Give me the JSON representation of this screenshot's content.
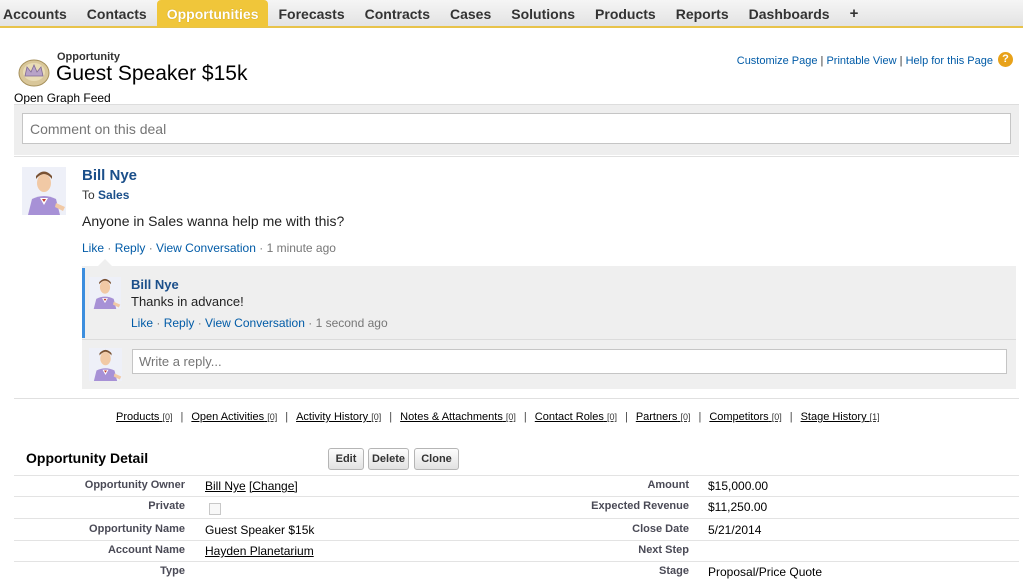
{
  "nav": {
    "tabs": [
      "Accounts",
      "Contacts",
      "Opportunities",
      "Forecasts",
      "Contracts",
      "Cases",
      "Solutions",
      "Products",
      "Reports",
      "Dashboards"
    ],
    "active": "Opportunities",
    "plus": "+"
  },
  "header": {
    "object_type": "Opportunity",
    "title": "Guest Speaker $15k",
    "links": [
      "Customize Page",
      "Printable View",
      "Help for this Page"
    ],
    "help_icon": "?"
  },
  "feed": {
    "label": "Open Graph Feed",
    "comment_placeholder": "Comment on this deal",
    "post": {
      "author": "Bill Nye",
      "to_prefix": "To",
      "to_group": "Sales",
      "body": "Anyone in Sales wanna help me with this?",
      "actions": [
        "Like",
        "Reply",
        "View Conversation"
      ],
      "time": "1 minute ago"
    },
    "comment": {
      "author": "Bill Nye",
      "body": "Thanks in advance!",
      "actions": [
        "Like",
        "Reply",
        "View Conversation"
      ],
      "time": "1 second ago"
    },
    "reply_placeholder": "Write a reply..."
  },
  "related": [
    {
      "label": "Products",
      "count": "[0]"
    },
    {
      "label": "Open Activities",
      "count": "[0]"
    },
    {
      "label": "Activity History",
      "count": "[0]"
    },
    {
      "label": "Notes & Attachments",
      "count": "[0]"
    },
    {
      "label": "Contact Roles",
      "count": "[0]"
    },
    {
      "label": "Partners",
      "count": "[0]"
    },
    {
      "label": "Competitors",
      "count": "[0]"
    },
    {
      "label": "Stage History",
      "count": "[1]"
    }
  ],
  "detail": {
    "title": "Opportunity Detail",
    "buttons": {
      "edit": "Edit",
      "delete": "Delete",
      "clone": "Clone"
    },
    "left": [
      {
        "label": "Opportunity Owner",
        "value": "Bill Nye",
        "extra": "[Change]"
      },
      {
        "label": "Private",
        "value": ""
      },
      {
        "label": "Opportunity Name",
        "value": "Guest Speaker $15k"
      },
      {
        "label": "Account Name",
        "value": "Hayden Planetarium"
      },
      {
        "label": "Type",
        "value": ""
      }
    ],
    "right": [
      {
        "label": "Amount",
        "value": "$15,000.00"
      },
      {
        "label": "Expected Revenue",
        "value": "$11,250.00"
      },
      {
        "label": "Close Date",
        "value": "5/21/2014"
      },
      {
        "label": "Next Step",
        "value": ""
      },
      {
        "label": "Stage",
        "value": "Proposal/Price Quote"
      }
    ]
  }
}
